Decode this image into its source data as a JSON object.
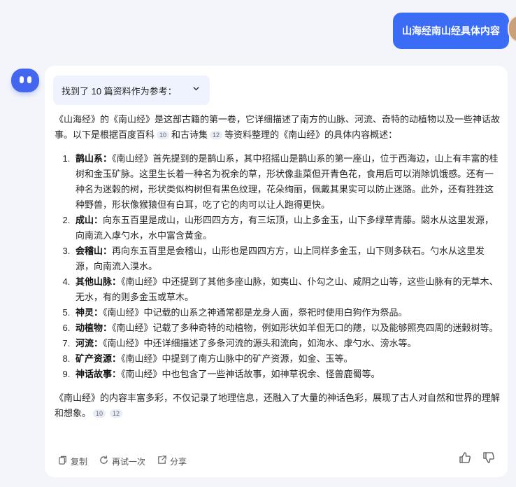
{
  "user_message": "山海经南山经具体内容",
  "refs_label": "找到了 10 篇资料作为参考：",
  "intro": {
    "part1": "《山海经》的《南山经》是这部古籍的第一卷，它详细描述了南方的山脉、河流、奇特的动植物以及一些神话故事。以下是根据百度百科",
    "cite1": "10",
    "part2": "和古诗集",
    "cite2": "12",
    "part3": "等资料整理的《南山经》的具体内容概述："
  },
  "items": [
    {
      "title": "鹊山系：",
      "text": "《南山经》首先提到的是鹊山系，其中招摇山是鹊山系的第一座山，位于西海边，山上有丰富的桂树和金玉矿脉。这里生长着一种名为祝余的草，形状像韭菜但开青色花，食用后可以消除饥饿感。还有一种名为迷榖的树，形状类似构树但有黑色纹理，花朵绚丽，佩戴其果实可以防止迷路。此外，还有狌狌这种野兽，形状像猴猿但有白耳，吃了它的肉可以让人跑得更快。"
    },
    {
      "title": "成山：",
      "text": "向东五百里是成山，山形四四方方，有三坛顶，山上多金玉，山下多绿草青藤。閟水从这里发源，向南流入虖勺水，水中富含黄金。"
    },
    {
      "title": "会稽山：",
      "text": "再向东五百里是会稽山，山形也是四四方方，山上同样多金玉，山下则多砆石。勺水从这里发源，向南流入湨水。"
    },
    {
      "title": "其他山脉：",
      "text": "《南山经》中还提到了其他多座山脉，如夷山、仆勾之山、咸阴之山等，这些山脉有的无草木、无水，有的则多金玉或草木。"
    },
    {
      "title": "神灵：",
      "text": "《南山经》中记载的山系之神通常都是龙身人面，祭祀时使用白狗作为祭品。"
    },
    {
      "title": "动植物：",
      "text": "《南山经》记载了多种奇特的动植物，例如形状如羊但无口的䍺，以及能够照亮四周的迷榖树等。"
    },
    {
      "title": "河流：",
      "text": "《南山经》中还详细描述了多条河流的源头和流向，如洵水、虖勺水、滂水等。"
    },
    {
      "title": "矿产资源：",
      "text": "《南山经》中提到了南方山脉中的矿产资源，如金、玉等。"
    },
    {
      "title": "神话故事：",
      "text": "《南山经》中也包含了一些神话故事，如神草祝余、怪兽鹿蜀等。"
    }
  ],
  "conclusion": {
    "text": "《南山经》的内容丰富多彩，不仅记录了地理信息，还融入了大量的神话色彩，展现了古人对自然和世界的理解和想象。",
    "cite1": "10",
    "cite2": "12"
  },
  "actions": {
    "copy": "复制",
    "retry": "再试一次",
    "share": "分享"
  },
  "colors": {
    "accent": "#3b6cf6",
    "bot_avatar": "#4466ee",
    "page_bg": "#f3f5fb"
  },
  "icons": [
    "copy-icon",
    "retry-icon",
    "share-icon",
    "thumbs-up-icon",
    "thumbs-down-icon",
    "chevron-down-icon"
  ]
}
